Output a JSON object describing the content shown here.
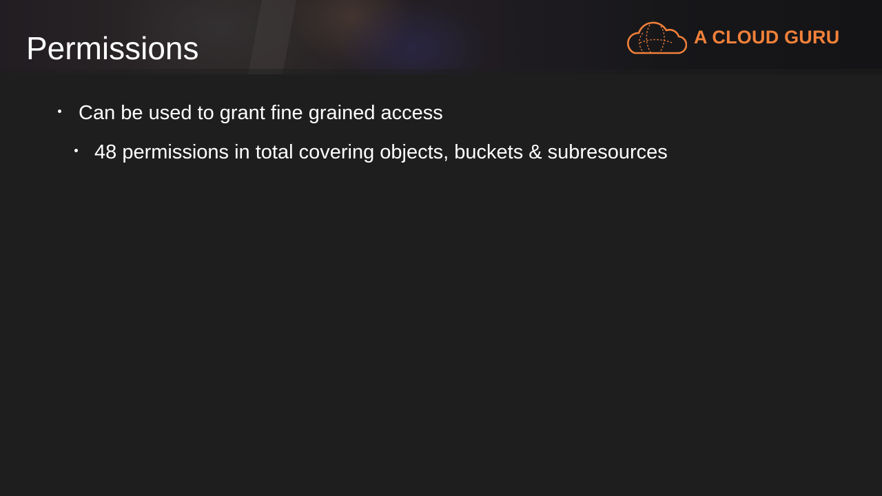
{
  "slide": {
    "title": "Permissions",
    "logo": {
      "text": "A CLOUD GURU",
      "icon": "cloud-logo-icon",
      "color": "#f2813a"
    },
    "bullets": [
      {
        "level": 1,
        "text": "Can be used to grant fine grained access"
      },
      {
        "level": 2,
        "text": "48 permissions in total covering objects, buckets & subresources"
      }
    ]
  }
}
